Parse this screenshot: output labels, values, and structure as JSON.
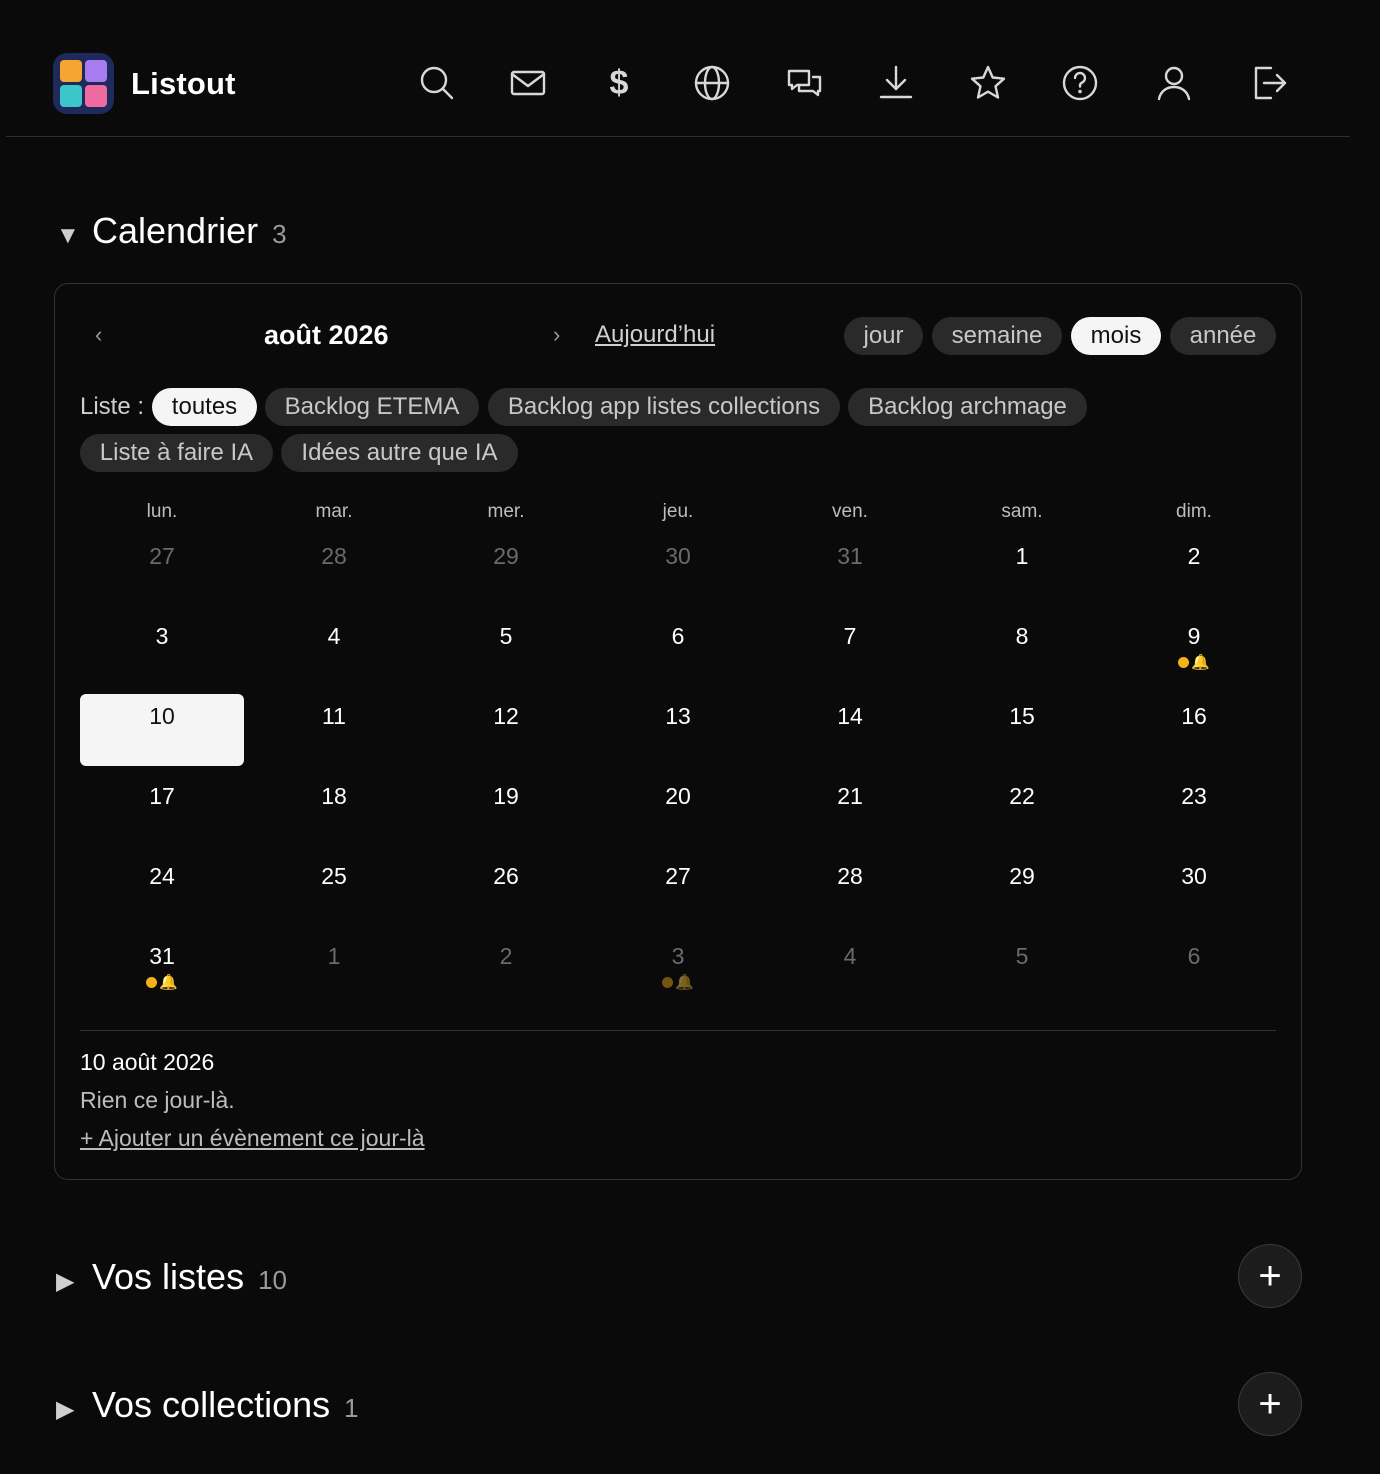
{
  "app": {
    "name": "Listout"
  },
  "nav_icons": [
    "search-icon",
    "mail-icon",
    "dollar-icon",
    "globe-icon",
    "chat-icon",
    "download-icon",
    "star-icon",
    "help-icon",
    "user-icon",
    "logout-icon"
  ],
  "nav": {
    "dollar_glyph": "$"
  },
  "calendar_section": {
    "caret": "▼",
    "title": "Calendrier",
    "count": "3",
    "prev": "‹",
    "next": "›",
    "month_title": "août 2026",
    "today_label": "Aujourd’hui",
    "views": [
      {
        "label": "jour",
        "active": false
      },
      {
        "label": "semaine",
        "active": false
      },
      {
        "label": "mois",
        "active": true
      },
      {
        "label": "année",
        "active": false
      }
    ],
    "list_filter_label": "Liste :",
    "list_filters": [
      {
        "label": "toutes",
        "active": true
      },
      {
        "label": "Backlog ETEMA",
        "active": false
      },
      {
        "label": "Backlog app listes collections",
        "active": false
      },
      {
        "label": "Backlog archmage",
        "active": false
      },
      {
        "label": "Liste à faire IA",
        "active": false
      },
      {
        "label": "Idées autre que IA",
        "active": false
      }
    ],
    "weekdays": [
      "lun.",
      "mar.",
      "mer.",
      "jeu.",
      "ven.",
      "sam.",
      "dim."
    ],
    "weeks": [
      [
        {
          "day": "27",
          "other": true
        },
        {
          "day": "28",
          "other": true
        },
        {
          "day": "29",
          "other": true
        },
        {
          "day": "30",
          "other": true
        },
        {
          "day": "31",
          "other": true
        },
        {
          "day": "1"
        },
        {
          "day": "2"
        }
      ],
      [
        {
          "day": "3"
        },
        {
          "day": "4"
        },
        {
          "day": "5"
        },
        {
          "day": "6"
        },
        {
          "day": "7"
        },
        {
          "day": "8"
        },
        {
          "day": "9",
          "events": true
        }
      ],
      [
        {
          "day": "10",
          "selected": true
        },
        {
          "day": "11"
        },
        {
          "day": "12"
        },
        {
          "day": "13"
        },
        {
          "day": "14"
        },
        {
          "day": "15"
        },
        {
          "day": "16"
        }
      ],
      [
        {
          "day": "17"
        },
        {
          "day": "18"
        },
        {
          "day": "19"
        },
        {
          "day": "20"
        },
        {
          "day": "21"
        },
        {
          "day": "22"
        },
        {
          "day": "23"
        }
      ],
      [
        {
          "day": "24"
        },
        {
          "day": "25"
        },
        {
          "day": "26"
        },
        {
          "day": "27"
        },
        {
          "day": "28"
        },
        {
          "day": "29"
        },
        {
          "day": "30"
        }
      ],
      [
        {
          "day": "31",
          "events": true
        },
        {
          "day": "1",
          "other": true
        },
        {
          "day": "2",
          "other": true
        },
        {
          "day": "3",
          "other": true,
          "events": true
        },
        {
          "day": "4",
          "other": true
        },
        {
          "day": "5",
          "other": true
        },
        {
          "day": "6",
          "other": true
        }
      ]
    ],
    "event_marker": {
      "dot_color": "#f5b11a",
      "bell": "🔔"
    },
    "selected_date": "10 août 2026",
    "empty_message": "Rien ce jour-là.",
    "add_event_label": "+ Ajouter un évènement ce jour-là"
  },
  "lists_section": {
    "caret": "▶",
    "title": "Vos listes",
    "count": "10",
    "add_label": "+"
  },
  "collections_section": {
    "caret": "▶",
    "title": "Vos collections",
    "count": "1",
    "add_label": "+"
  }
}
